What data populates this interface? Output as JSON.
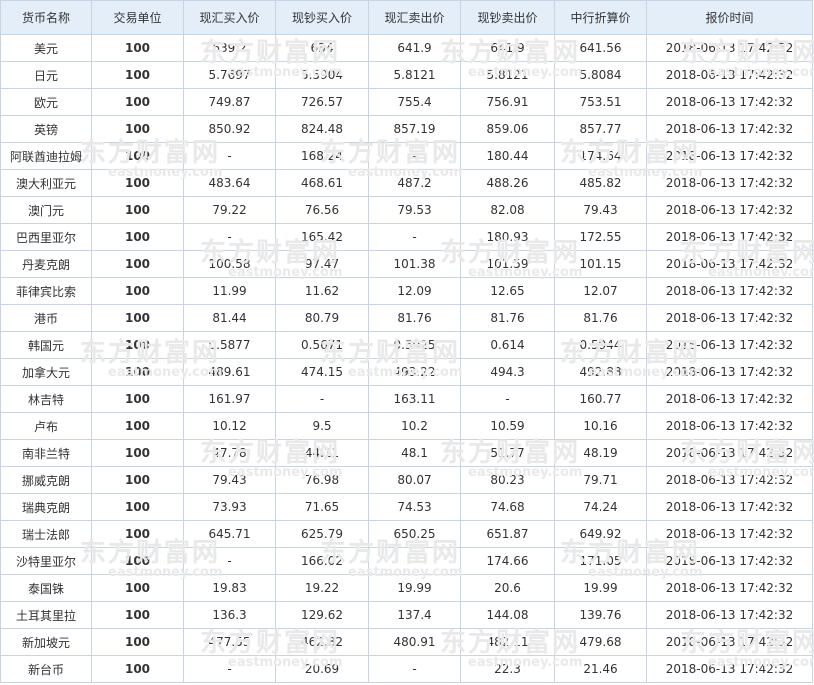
{
  "table": {
    "headers": [
      "货币名称",
      "交易单位",
      "现汇买入价",
      "现钞买入价",
      "现汇卖出价",
      "现钞卖出价",
      "中行折算价",
      "报价时间"
    ],
    "rows": [
      [
        "美元",
        "100",
        "639.2",
        "634",
        "641.9",
        "641.9",
        "641.56",
        "2018-06-13 17:42:32"
      ],
      [
        "日元",
        "100",
        "5.7697",
        "5.5904",
        "5.8121",
        "5.8121",
        "5.8084",
        "2018-06-13 17:42:32"
      ],
      [
        "欧元",
        "100",
        "749.87",
        "726.57",
        "755.4",
        "756.91",
        "753.51",
        "2018-06-13 17:42:32"
      ],
      [
        "英镑",
        "100",
        "850.92",
        "824.48",
        "857.19",
        "859.06",
        "857.77",
        "2018-06-13 17:42:32"
      ],
      [
        "阿联酋迪拉姆",
        "100",
        "-",
        "168.24",
        "-",
        "180.44",
        "174.64",
        "2018-06-13 17:42:32"
      ],
      [
        "澳大利亚元",
        "100",
        "483.64",
        "468.61",
        "487.2",
        "488.26",
        "485.82",
        "2018-06-13 17:42:32"
      ],
      [
        "澳门元",
        "100",
        "79.22",
        "76.56",
        "79.53",
        "82.08",
        "79.43",
        "2018-06-13 17:42:32"
      ],
      [
        "巴西里亚尔",
        "100",
        "-",
        "165.42",
        "-",
        "180.93",
        "172.55",
        "2018-06-13 17:42:32"
      ],
      [
        "丹麦克朗",
        "100",
        "100.58",
        "97.47",
        "101.38",
        "101.59",
        "101.15",
        "2018-06-13 17:42:32"
      ],
      [
        "菲律宾比索",
        "100",
        "11.99",
        "11.62",
        "12.09",
        "12.65",
        "12.07",
        "2018-06-13 17:42:32"
      ],
      [
        "港币",
        "100",
        "81.44",
        "80.79",
        "81.76",
        "81.76",
        "81.76",
        "2018-06-13 17:42:32"
      ],
      [
        "韩国元",
        "100",
        "0.5877",
        "0.5671",
        "0.5925",
        "0.614",
        "0.5944",
        "2018-06-13 17:42:32"
      ],
      [
        "加拿大元",
        "100",
        "489.61",
        "474.15",
        "493.22",
        "494.3",
        "492.88",
        "2018-06-13 17:42:32"
      ],
      [
        "林吉特",
        "100",
        "161.97",
        "-",
        "163.11",
        "-",
        "160.77",
        "2018-06-13 17:42:32"
      ],
      [
        "卢布",
        "100",
        "10.12",
        "9.5",
        "10.2",
        "10.59",
        "10.16",
        "2018-06-13 17:42:32"
      ],
      [
        "南非兰特",
        "100",
        "47.78",
        "44.11",
        "48.1",
        "51.77",
        "48.19",
        "2018-06-13 17:42:32"
      ],
      [
        "挪威克朗",
        "100",
        "79.43",
        "76.98",
        "80.07",
        "80.23",
        "79.71",
        "2018-06-13 17:42:32"
      ],
      [
        "瑞典克朗",
        "100",
        "73.93",
        "71.65",
        "74.53",
        "74.68",
        "74.24",
        "2018-06-13 17:42:32"
      ],
      [
        "瑞士法郎",
        "100",
        "645.71",
        "625.79",
        "650.25",
        "651.87",
        "649.92",
        "2018-06-13 17:42:32"
      ],
      [
        "沙特里亚尔",
        "100",
        "-",
        "166.02",
        "-",
        "174.66",
        "171.05",
        "2018-06-13 17:42:32"
      ],
      [
        "泰国铢",
        "100",
        "19.83",
        "19.22",
        "19.99",
        "20.6",
        "19.99",
        "2018-06-13 17:42:32"
      ],
      [
        "土耳其里拉",
        "100",
        "136.3",
        "129.62",
        "137.4",
        "144.08",
        "139.76",
        "2018-06-13 17:42:32"
      ],
      [
        "新加坡元",
        "100",
        "477.55",
        "462.82",
        "480.91",
        "482.11",
        "479.68",
        "2018-06-13 17:42:32"
      ],
      [
        "新台币",
        "100",
        "-",
        "20.69",
        "-",
        "22.3",
        "21.46",
        "2018-06-13 17:42:32"
      ]
    ]
  },
  "watermark": {
    "brand_cn": "东方财富网",
    "brand_en": "eastmoney.com"
  },
  "colors": {
    "header_bg": "#e4eef9",
    "border": "#c7d4e3",
    "watermark": "#e9e9e9"
  }
}
